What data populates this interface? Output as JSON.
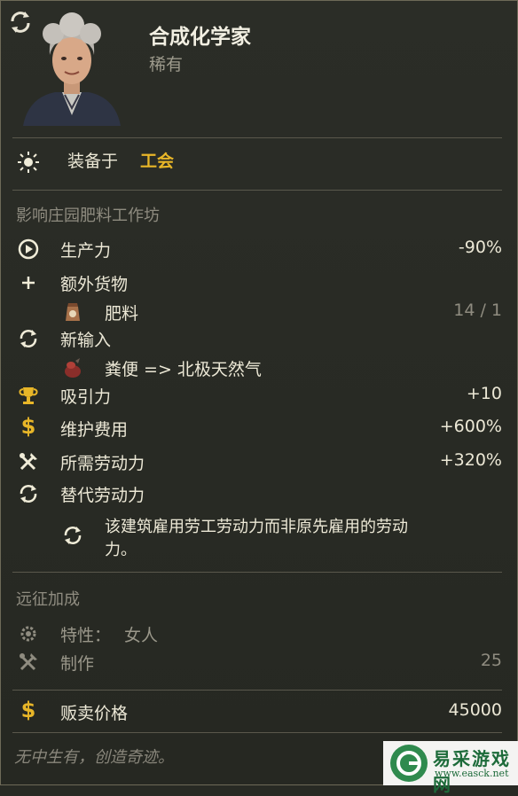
{
  "header": {
    "title": "合成化学家",
    "rarity": "稀有"
  },
  "equipped": {
    "label": "装备于",
    "building": "工会"
  },
  "affects_header": "影响庄园肥料工作坊",
  "stats": {
    "productivity": {
      "label": "生产力",
      "value": "-90%"
    },
    "extra_goods": {
      "label": "额外货物"
    },
    "fertilizer": {
      "label": "肥料",
      "value": "14 / 1"
    },
    "new_input": {
      "label": "新输入"
    },
    "conversion": {
      "label": "粪便 => 北极天然气"
    },
    "appeal": {
      "label": "吸引力",
      "value": "+10"
    },
    "upkeep": {
      "label": "维护费用",
      "value": "+600%"
    },
    "workforce": {
      "label": "所需劳动力",
      "value": "+320%"
    },
    "alt_workforce": {
      "label": "替代劳动力"
    },
    "alt_desc": {
      "line1": "该建筑雇用劳工劳动力而非原先雇用的劳动",
      "line2": "力。"
    }
  },
  "expedition": {
    "header": "远征加成",
    "trait": {
      "label": "特性：",
      "value": "女人"
    },
    "crafting": {
      "label": "制作",
      "value": "25"
    }
  },
  "sell": {
    "label": "贩卖价格",
    "value": "45000"
  },
  "flavor": "无中生有，创造奇迹。",
  "watermark": {
    "name": "易采游戏网",
    "url": "www.easck.net"
  },
  "colors": {
    "accent": "#e8b628",
    "background": "#282a24",
    "text": "#ece8d6",
    "muted": "#8f8c80"
  },
  "icons": [
    "swap-icon",
    "sun-icon",
    "gauge-icon",
    "plus-icon",
    "fertilizer-icon",
    "cycle-icon",
    "manure-icon",
    "trophy-icon",
    "dollar-icon",
    "tools-icon",
    "gear-icon"
  ]
}
